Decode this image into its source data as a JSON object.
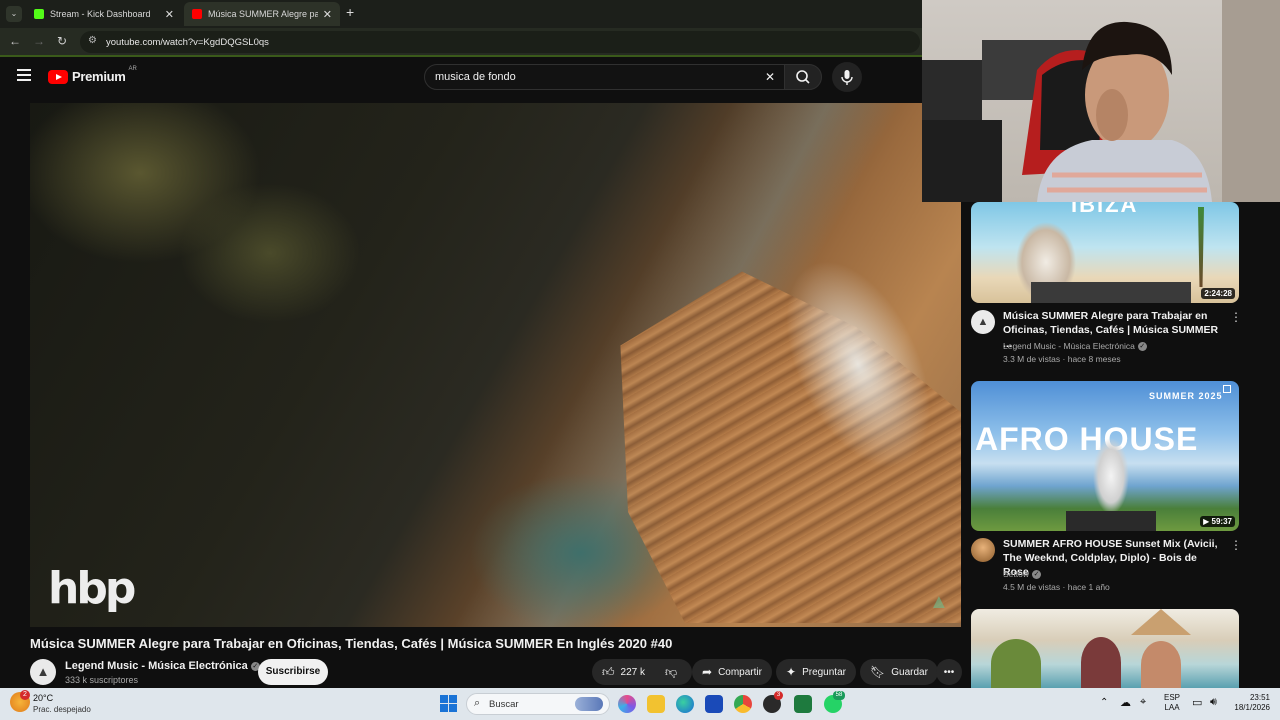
{
  "browser": {
    "tabs": [
      {
        "label": "Stream - Kick Dashboard"
      },
      {
        "label": "Música SUMMER Alegre para T"
      }
    ],
    "new_tab": "+",
    "url": "youtube.com/watch?v=KgdDQGSL0qs"
  },
  "youtube": {
    "logo": "Premium",
    "region": "AR",
    "search_value": "musica de fondo"
  },
  "player": {
    "overlay_logo": "hbp"
  },
  "video": {
    "title": "Música SUMMER Alegre para Trabajar en Oficinas, Tiendas, Cafés | Música SUMMER En Inglés 2020 #40",
    "channel": "Legend Music - Música Electrónica",
    "subscribers": "333 k suscriptores",
    "subscribe_label": "Suscribirse",
    "likes": "227 k",
    "share_label": "Compartir",
    "ask_label": "Preguntar",
    "save_label": "Guardar"
  },
  "sidebar": {
    "items": [
      {
        "title": "Música SUMMER Alegre para Trabajar en Oficinas, Tiendas, Cafés | Música SUMMER ...",
        "channel": "Legend Music - Música Electrónica",
        "meta": "3.3 M de vistas · hace 8 meses",
        "duration": "2:24:28",
        "thumb_text": "IBIZA"
      },
      {
        "title": "SUMMER AFRO HOUSE Sunset Mix (Avicii, The Weeknd, Coldplay, Diplo) - Bois de Rose ...",
        "channel": "Settow",
        "meta": "4.5 M de vistas · hace 1 año",
        "duration": "59:37",
        "thumb_text": "AFRO HOUSE",
        "thumb_subtext": "SUMMER 2025"
      }
    ]
  },
  "taskbar": {
    "weather_temp": "20°C",
    "weather_desc": "Prac. despejado",
    "weather_badge": "2",
    "search_placeholder": "Buscar",
    "lang_top": "ESP",
    "lang_bottom": "LAA",
    "time": "23:51",
    "date": "18/1/2026",
    "app_badge_one": "3",
    "app_badge_two": "58"
  },
  "colors": {
    "youtube_red": "#ff0000",
    "page_bg": "#0f0f0f",
    "tab_active_bg": "#2d3228",
    "kick_green": "#53fc18",
    "taskbar_bg": "#dfe6ec"
  }
}
